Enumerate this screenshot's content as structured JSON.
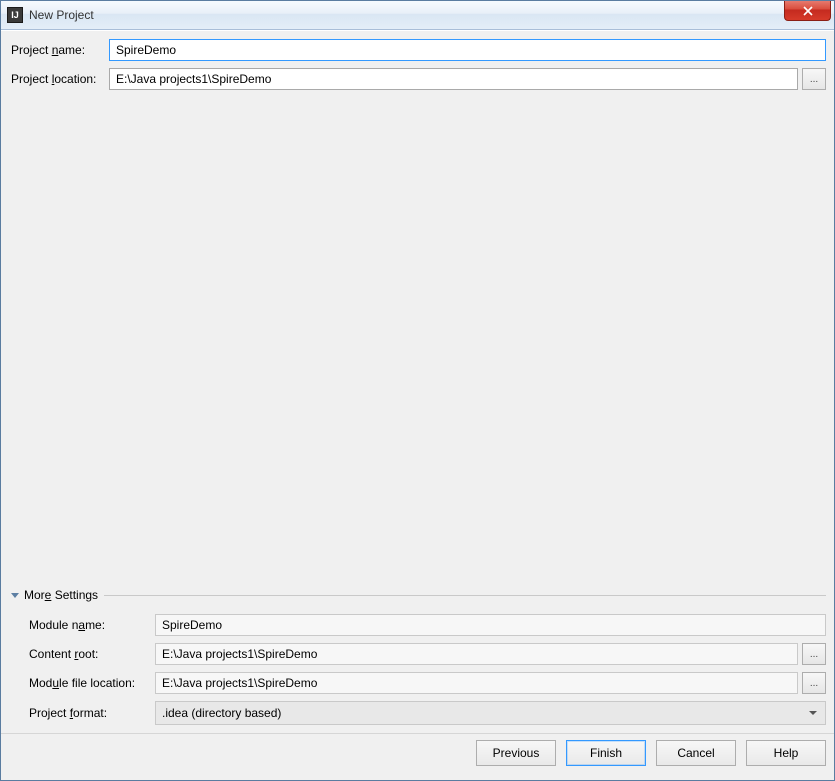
{
  "window": {
    "title": "New Project"
  },
  "top": {
    "project_name_label_pre": "Project ",
    "project_name_label_u": "n",
    "project_name_label_post": "ame:",
    "project_name_value": "SpireDemo",
    "project_location_label_pre": "Project ",
    "project_location_label_u": "l",
    "project_location_label_post": "ocation:",
    "project_location_value": "E:\\Java projects1\\SpireDemo",
    "browse": "..."
  },
  "more": {
    "header_pre": "Mor",
    "header_u": "e",
    "header_post": " Settings",
    "module_name_label_pre": "Module n",
    "module_name_label_u": "a",
    "module_name_label_post": "me:",
    "module_name_value": "SpireDemo",
    "content_root_label_pre": "Content ",
    "content_root_label_u": "r",
    "content_root_label_post": "oot:",
    "content_root_value": "E:\\Java projects1\\SpireDemo",
    "module_file_label_pre": "Mod",
    "module_file_label_u": "u",
    "module_file_label_post": "le file location:",
    "module_file_value": "E:\\Java projects1\\SpireDemo",
    "project_format_label_pre": "Project ",
    "project_format_label_u": "f",
    "project_format_label_post": "ormat:",
    "project_format_value": ".idea (directory based)"
  },
  "buttons": {
    "previous": "Previous",
    "finish": "Finish",
    "cancel": "Cancel",
    "help": "Help"
  }
}
